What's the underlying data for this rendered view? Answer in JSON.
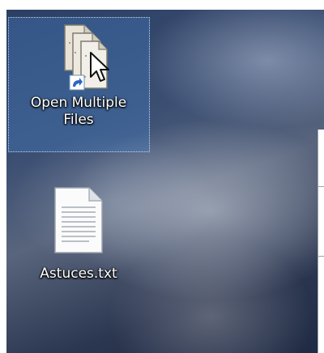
{
  "desktop": {
    "icons": [
      {
        "label": "Open Multiple\nFiles",
        "icon": "open-multiple-files-shortcut-icon",
        "selected": true
      },
      {
        "label": "Astuces.txt",
        "icon": "text-file-icon",
        "selected": false
      }
    ]
  },
  "colors": {
    "selection_fill": "#4682c8",
    "selection_border": "#d2e6ff",
    "label_text": "#ffffff"
  }
}
